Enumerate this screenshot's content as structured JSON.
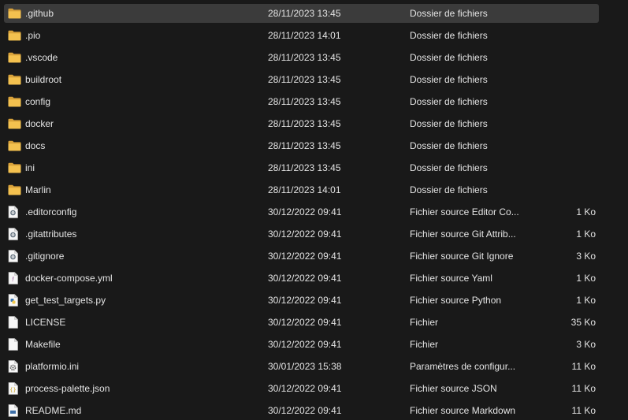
{
  "colors": {
    "background": "#191919",
    "selected_row": "#3b3b3b",
    "folder": "#f4c14f",
    "text": "#e4e4e4"
  },
  "files": [
    {
      "name": ".github",
      "date": "28/11/2023 13:45",
      "type": "Dossier de fichiers",
      "size": "",
      "icon": "folder-icon",
      "selected": true
    },
    {
      "name": ".pio",
      "date": "28/11/2023 14:01",
      "type": "Dossier de fichiers",
      "size": "",
      "icon": "folder-icon"
    },
    {
      "name": ".vscode",
      "date": "28/11/2023 13:45",
      "type": "Dossier de fichiers",
      "size": "",
      "icon": "folder-icon"
    },
    {
      "name": "buildroot",
      "date": "28/11/2023 13:45",
      "type": "Dossier de fichiers",
      "size": "",
      "icon": "folder-icon"
    },
    {
      "name": "config",
      "date": "28/11/2023 13:45",
      "type": "Dossier de fichiers",
      "size": "",
      "icon": "folder-icon"
    },
    {
      "name": "docker",
      "date": "28/11/2023 13:45",
      "type": "Dossier de fichiers",
      "size": "",
      "icon": "folder-icon"
    },
    {
      "name": "docs",
      "date": "28/11/2023 13:45",
      "type": "Dossier de fichiers",
      "size": "",
      "icon": "folder-icon"
    },
    {
      "name": "ini",
      "date": "28/11/2023 13:45",
      "type": "Dossier de fichiers",
      "size": "",
      "icon": "folder-icon"
    },
    {
      "name": "Marlin",
      "date": "28/11/2023 14:01",
      "type": "Dossier de fichiers",
      "size": "",
      "icon": "folder-icon"
    },
    {
      "name": ".editorconfig",
      "date": "30/12/2022 09:41",
      "type": "Fichier source Editor Co...",
      "size": "1 Ko",
      "icon": "config-file-icon"
    },
    {
      "name": ".gitattributes",
      "date": "30/12/2022 09:41",
      "type": "Fichier source Git Attrib...",
      "size": "1 Ko",
      "icon": "config-file-icon"
    },
    {
      "name": ".gitignore",
      "date": "30/12/2022 09:41",
      "type": "Fichier source Git Ignore",
      "size": "3 Ko",
      "icon": "config-file-icon"
    },
    {
      "name": "docker-compose.yml",
      "date": "30/12/2022 09:41",
      "type": "Fichier source Yaml",
      "size": "1 Ko",
      "icon": "yaml-file-icon"
    },
    {
      "name": "get_test_targets.py",
      "date": "30/12/2022 09:41",
      "type": "Fichier source Python",
      "size": "1 Ko",
      "icon": "python-file-icon"
    },
    {
      "name": "LICENSE",
      "date": "30/12/2022 09:41",
      "type": "Fichier",
      "size": "35 Ko",
      "icon": "blank-file-icon"
    },
    {
      "name": "Makefile",
      "date": "30/12/2022 09:41",
      "type": "Fichier",
      "size": "3 Ko",
      "icon": "blank-file-icon"
    },
    {
      "name": "platformio.ini",
      "date": "30/01/2023 15:38",
      "type": "Paramètres de configur...",
      "size": "11 Ko",
      "icon": "settings-file-icon"
    },
    {
      "name": "process-palette.json",
      "date": "30/12/2022 09:41",
      "type": "Fichier source JSON",
      "size": "11 Ko",
      "icon": "json-file-icon"
    },
    {
      "name": "README.md",
      "date": "30/12/2022 09:41",
      "type": "Fichier source Markdown",
      "size": "11 Ko",
      "icon": "markdown-file-icon"
    }
  ]
}
